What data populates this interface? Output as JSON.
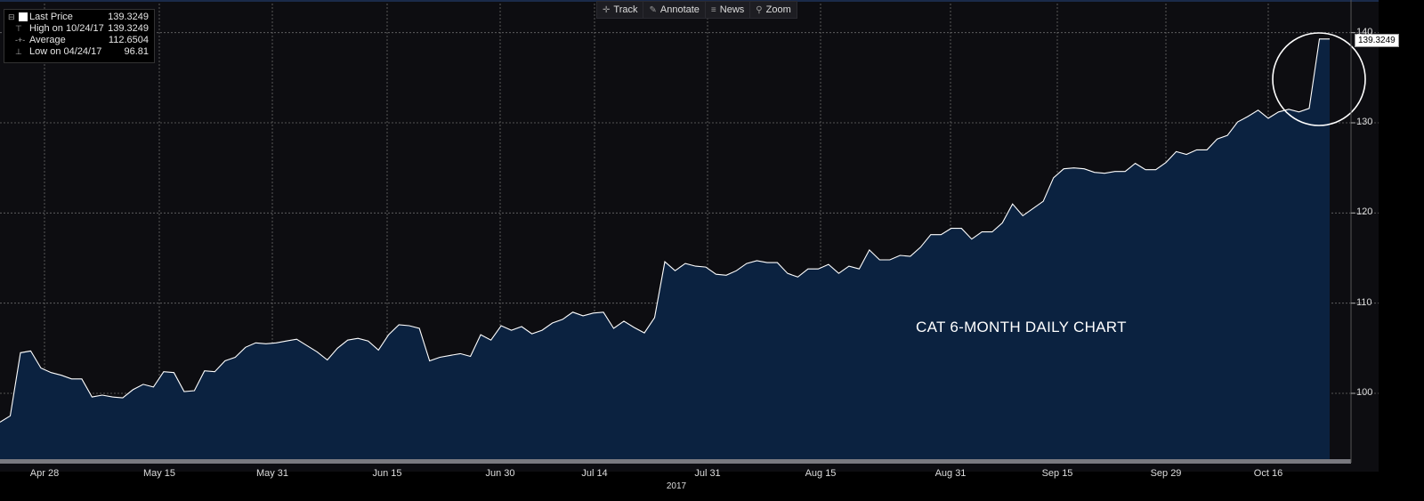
{
  "toolbar": {
    "track": "Track",
    "annotate": "Annotate",
    "news": "News",
    "zoom": "Zoom"
  },
  "legend": {
    "last_price_label": "Last Price",
    "last_price_value": "139.3249",
    "high_label": "High on 10/24/17",
    "high_value": "139.3249",
    "average_label": "Average",
    "average_value": "112.6504",
    "low_label": "Low on 04/24/17",
    "low_value": "96.81"
  },
  "price_tag": "139.3249",
  "annotation": "CAT 6-MONTH DAILY CHART",
  "year_label": "2017",
  "colors": {
    "background": "#0d0d11",
    "area_fill": "#0b2240",
    "line": "#ffffff",
    "grid": "#6a6a6a"
  },
  "chart_data": {
    "type": "area",
    "x_tick_labels": [
      "Apr 28",
      "May 15",
      "May 31",
      "Jun 15",
      "Jun 30",
      "Jul 14",
      "Jul 31",
      "Aug 15",
      "Aug 31",
      "Sep 15",
      "Sep 29",
      "Oct 16"
    ],
    "y_tick_labels": [
      "100",
      "110",
      "120",
      "130",
      "140"
    ],
    "ylim": [
      95,
      142
    ],
    "grid": true,
    "series": [
      {
        "values": [
          96.8,
          97.5,
          104.5,
          104.7,
          102.8,
          102.3,
          102.0,
          101.6,
          101.6,
          99.6,
          99.8,
          99.6,
          99.5,
          100.4,
          101.0,
          100.7,
          102.4,
          102.3,
          100.2,
          100.3,
          102.5,
          102.4,
          103.6,
          104.0,
          105.1,
          105.6,
          105.5,
          105.6,
          105.8,
          106.0,
          105.3,
          104.6,
          103.7,
          105.0,
          105.9,
          106.1,
          105.8,
          104.8,
          106.5,
          107.6,
          107.5,
          107.2,
          103.6,
          104.0,
          104.2,
          104.4,
          104.1,
          106.5,
          105.9,
          107.5,
          107.0,
          107.4,
          106.6,
          107.0,
          107.8,
          108.2,
          109.0,
          108.6,
          108.9,
          109.0,
          107.2,
          108.0,
          107.3,
          106.7,
          108.4,
          114.6,
          113.6,
          114.4,
          114.1,
          114.0,
          113.2,
          113.1,
          113.6,
          114.4,
          114.7,
          114.5,
          114.5,
          113.3,
          112.9,
          113.8,
          113.8,
          114.3,
          113.3,
          114.1,
          113.8,
          115.9,
          114.8,
          114.8,
          115.3,
          115.2,
          116.2,
          117.6,
          117.6,
          118.3,
          118.3,
          117.1,
          117.9,
          117.9,
          118.9,
          121.0,
          119.7,
          120.5,
          121.3,
          123.9,
          124.9,
          125.0,
          124.9,
          124.5,
          124.4,
          124.6,
          124.6,
          125.5,
          124.8,
          124.8,
          125.6,
          126.8,
          126.5,
          127.0,
          127.0,
          128.2,
          128.6,
          130.1,
          130.7,
          131.4,
          130.5,
          131.2,
          131.5,
          131.2,
          131.6,
          139.3,
          139.3
        ]
      }
    ]
  }
}
